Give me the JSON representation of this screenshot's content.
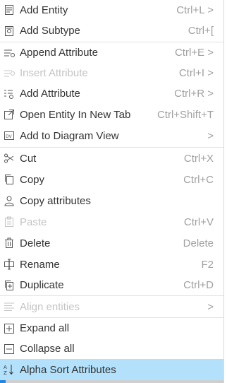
{
  "menu": {
    "items": [
      {
        "label": "Add Entity",
        "shortcut": "Ctrl+L >",
        "icon": "add-entity-icon"
      },
      {
        "label": "Add Subtype",
        "shortcut": "Ctrl+[",
        "icon": "add-subtype-icon"
      },
      {
        "label": "Append Attribute",
        "shortcut": "Ctrl+E >",
        "icon": "append-attribute-icon"
      },
      {
        "label": "Insert Attribute",
        "shortcut": "Ctrl+I >",
        "icon": "insert-attribute-icon",
        "disabled": true
      },
      {
        "label": "Add Attribute",
        "shortcut": "Ctrl+R >",
        "icon": "add-attribute-icon"
      },
      {
        "label": "Open Entity In New Tab",
        "shortcut": "Ctrl+Shift+T",
        "icon": "open-new-tab-icon"
      },
      {
        "label": "Add to Diagram View",
        "shortcut": ">",
        "icon": "diagram-view-icon"
      },
      {
        "label": "Cut",
        "shortcut": "Ctrl+X",
        "icon": "scissors-icon"
      },
      {
        "label": "Copy",
        "shortcut": "Ctrl+C",
        "icon": "copy-icon"
      },
      {
        "label": "Copy attributes",
        "shortcut": "",
        "icon": "copy-attributes-icon"
      },
      {
        "label": "Paste",
        "shortcut": "Ctrl+V",
        "icon": "paste-icon",
        "disabled": true
      },
      {
        "label": "Delete",
        "shortcut": "Delete",
        "icon": "trash-icon"
      },
      {
        "label": "Rename",
        "shortcut": "F2",
        "icon": "rename-icon"
      },
      {
        "label": "Duplicate",
        "shortcut": "Ctrl+D",
        "icon": "duplicate-icon"
      },
      {
        "label": "Align entities",
        "shortcut": ">",
        "icon": "align-icon",
        "disabled": true
      },
      {
        "label": "Expand all",
        "shortcut": "",
        "icon": "expand-all-icon"
      },
      {
        "label": "Collapse all",
        "shortcut": "",
        "icon": "collapse-all-icon"
      },
      {
        "label": "Alpha Sort Attributes",
        "shortcut": "",
        "icon": "alpha-sort-icon",
        "highlighted": true
      }
    ]
  },
  "colors": {
    "text": "#333333",
    "disabled": "#c4c4c4",
    "shortcut": "#a0a0a0",
    "highlight": "#b3e1fb"
  }
}
